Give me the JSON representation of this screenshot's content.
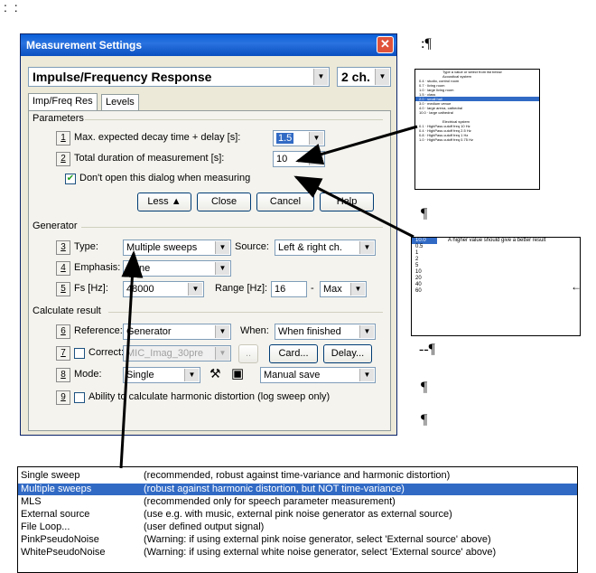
{
  "page": {
    "corner_dots": ": :"
  },
  "dialog": {
    "title": "Measurement Settings",
    "close_glyph": "✕",
    "mode_combo": "Impulse/Frequency Response",
    "channels_combo": "2 ch.",
    "tabs": [
      "Imp/Freq Res",
      "Levels"
    ],
    "parameters": {
      "heading": "Parameters",
      "row1": {
        "num": "1",
        "label": "Max. expected decay time + delay [s]:",
        "value": "1.5"
      },
      "row2": {
        "num": "2",
        "label": "Total duration of measurement [s]:",
        "value": "10"
      },
      "dont_open": "Don't open this dialog when measuring",
      "buttons": {
        "less": "Less  ▲",
        "close": "Close",
        "cancel": "Cancel",
        "help": "Help"
      }
    },
    "generator": {
      "heading": "Generator",
      "type": {
        "num": "3",
        "label": "Type:",
        "value": "Multiple sweeps"
      },
      "source_label": "Source:",
      "source_value": "Left & right ch.",
      "emphasis": {
        "num": "4",
        "label": "Emphasis:",
        "value": "None"
      },
      "fs": {
        "num": "5",
        "label": "Fs [Hz]:",
        "value": "48000"
      },
      "range_label": "Range [Hz]:",
      "range_from": "16",
      "range_dash": "-",
      "range_to": "Max"
    },
    "calculate": {
      "heading": "Calculate result",
      "reference": {
        "num": "6",
        "label": "Reference:",
        "value": "Generator"
      },
      "when_label": "When:",
      "when_value": "When finished",
      "correct": {
        "num": "7",
        "label": "Correct:",
        "value": "MIC_Imag_30pre"
      },
      "card_button": "Card...",
      "delay_button": "Delay...",
      "mode": {
        "num": "8",
        "label": "Mode:",
        "value": "Single"
      },
      "save_value": "Manual save",
      "harmonic": {
        "num": "9",
        "label": "Ability to calculate harmonic distortion (log sweep only)"
      }
    }
  },
  "right": {
    "pilcrows": [
      ":¶",
      "¶",
      "--¶",
      "¶",
      "¶"
    ],
    "callout_text": "A higher value should give a better result",
    "callout_values": [
      "10.0",
      "0.5",
      "1",
      "2",
      "5",
      "10",
      "20",
      "40",
      "60"
    ]
  },
  "listbox": {
    "rows": [
      {
        "name": "Single sweep",
        "desc": "(recommended, robust against time-variance and harmonic distortion)"
      },
      {
        "name": "Multiple sweeps",
        "desc": "(robust against harmonic distortion, but NOT time-variance)"
      },
      {
        "name": "MLS",
        "desc": "(recommended only for speech parameter measurement)"
      },
      {
        "name": "External source",
        "desc": "(use e.g. with music, external pink noise generator as external source)"
      },
      {
        "name": "File Loop...",
        "desc": "(user defined output signal)"
      },
      {
        "name": "PinkPseudoNoise",
        "desc": "(Warning: if using external pink noise generator, select 'External source' above)"
      },
      {
        "name": "WhitePseudoNoise",
        "desc": "(Warning: if using external white noise generator, select 'External source' above)"
      }
    ],
    "selected_index": 1
  },
  "colors": {
    "title_bar": "#0a5fd8",
    "selection": "#316ac5",
    "dialog_bg": "#ece9d8"
  }
}
